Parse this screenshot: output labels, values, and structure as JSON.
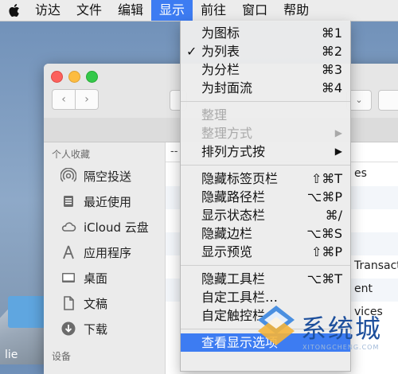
{
  "menubar": {
    "items": [
      {
        "label": "访达"
      },
      {
        "label": "文件"
      },
      {
        "label": "编辑"
      },
      {
        "label": "显示"
      },
      {
        "label": "前往"
      },
      {
        "label": "窗口"
      },
      {
        "label": "帮助"
      }
    ],
    "active_index": 3
  },
  "dropdown": {
    "groups": [
      [
        {
          "label": "为图标",
          "shortcut": "⌘1"
        },
        {
          "label": "为列表",
          "shortcut": "⌘2",
          "checked": "✓"
        },
        {
          "label": "为分栏",
          "shortcut": "⌘3"
        },
        {
          "label": "为封面流",
          "shortcut": "⌘4"
        }
      ],
      [
        {
          "label": "整理",
          "disabled": true
        },
        {
          "label": "整理方式",
          "shortcut": "▶",
          "disabled": true
        },
        {
          "label": "排列方式按",
          "shortcut": "▶"
        }
      ],
      [
        {
          "label": "隐藏标签页栏",
          "shortcut": "⇧⌘T"
        },
        {
          "label": "隐藏路径栏",
          "shortcut": "⌥⌘P"
        },
        {
          "label": "显示状态栏",
          "shortcut": "⌘/"
        },
        {
          "label": "隐藏边栏",
          "shortcut": "⌥⌘S"
        },
        {
          "label": "显示预览",
          "shortcut": "⇧⌘P"
        }
      ],
      [
        {
          "label": "隐藏工具栏",
          "shortcut": "⌥⌘T"
        },
        {
          "label": "自定工具栏…"
        },
        {
          "label": "自定触控栏…"
        }
      ],
      [
        {
          "label": "查看显示选项",
          "shortcut": "",
          "highlight": true
        }
      ]
    ]
  },
  "sidebar": {
    "section_title": "个人收藏",
    "items": [
      {
        "label": "隔空投送",
        "icon": "airdrop-icon"
      },
      {
        "label": "最近使用",
        "icon": "recents-icon"
      },
      {
        "label": "iCloud 云盘",
        "icon": "cloud-icon"
      },
      {
        "label": "应用程序",
        "icon": "applications-icon"
      },
      {
        "label": "桌面",
        "icon": "desktop-icon"
      },
      {
        "label": "文稿",
        "icon": "documents-icon"
      },
      {
        "label": "下载",
        "icon": "downloads-icon"
      }
    ],
    "section2_title": "设备"
  },
  "content": {
    "header_fragment": "--",
    "rows": [
      "es",
      "",
      "",
      "",
      "Transacti",
      "ent",
      "vices"
    ]
  },
  "desktop": {
    "folder_label": "lie"
  },
  "watermark": {
    "text": "系统城",
    "sub": "XITONGCHENG.COM"
  },
  "colors": {
    "accent": "#3d7cf2",
    "watermark": "#1d4f9c"
  }
}
